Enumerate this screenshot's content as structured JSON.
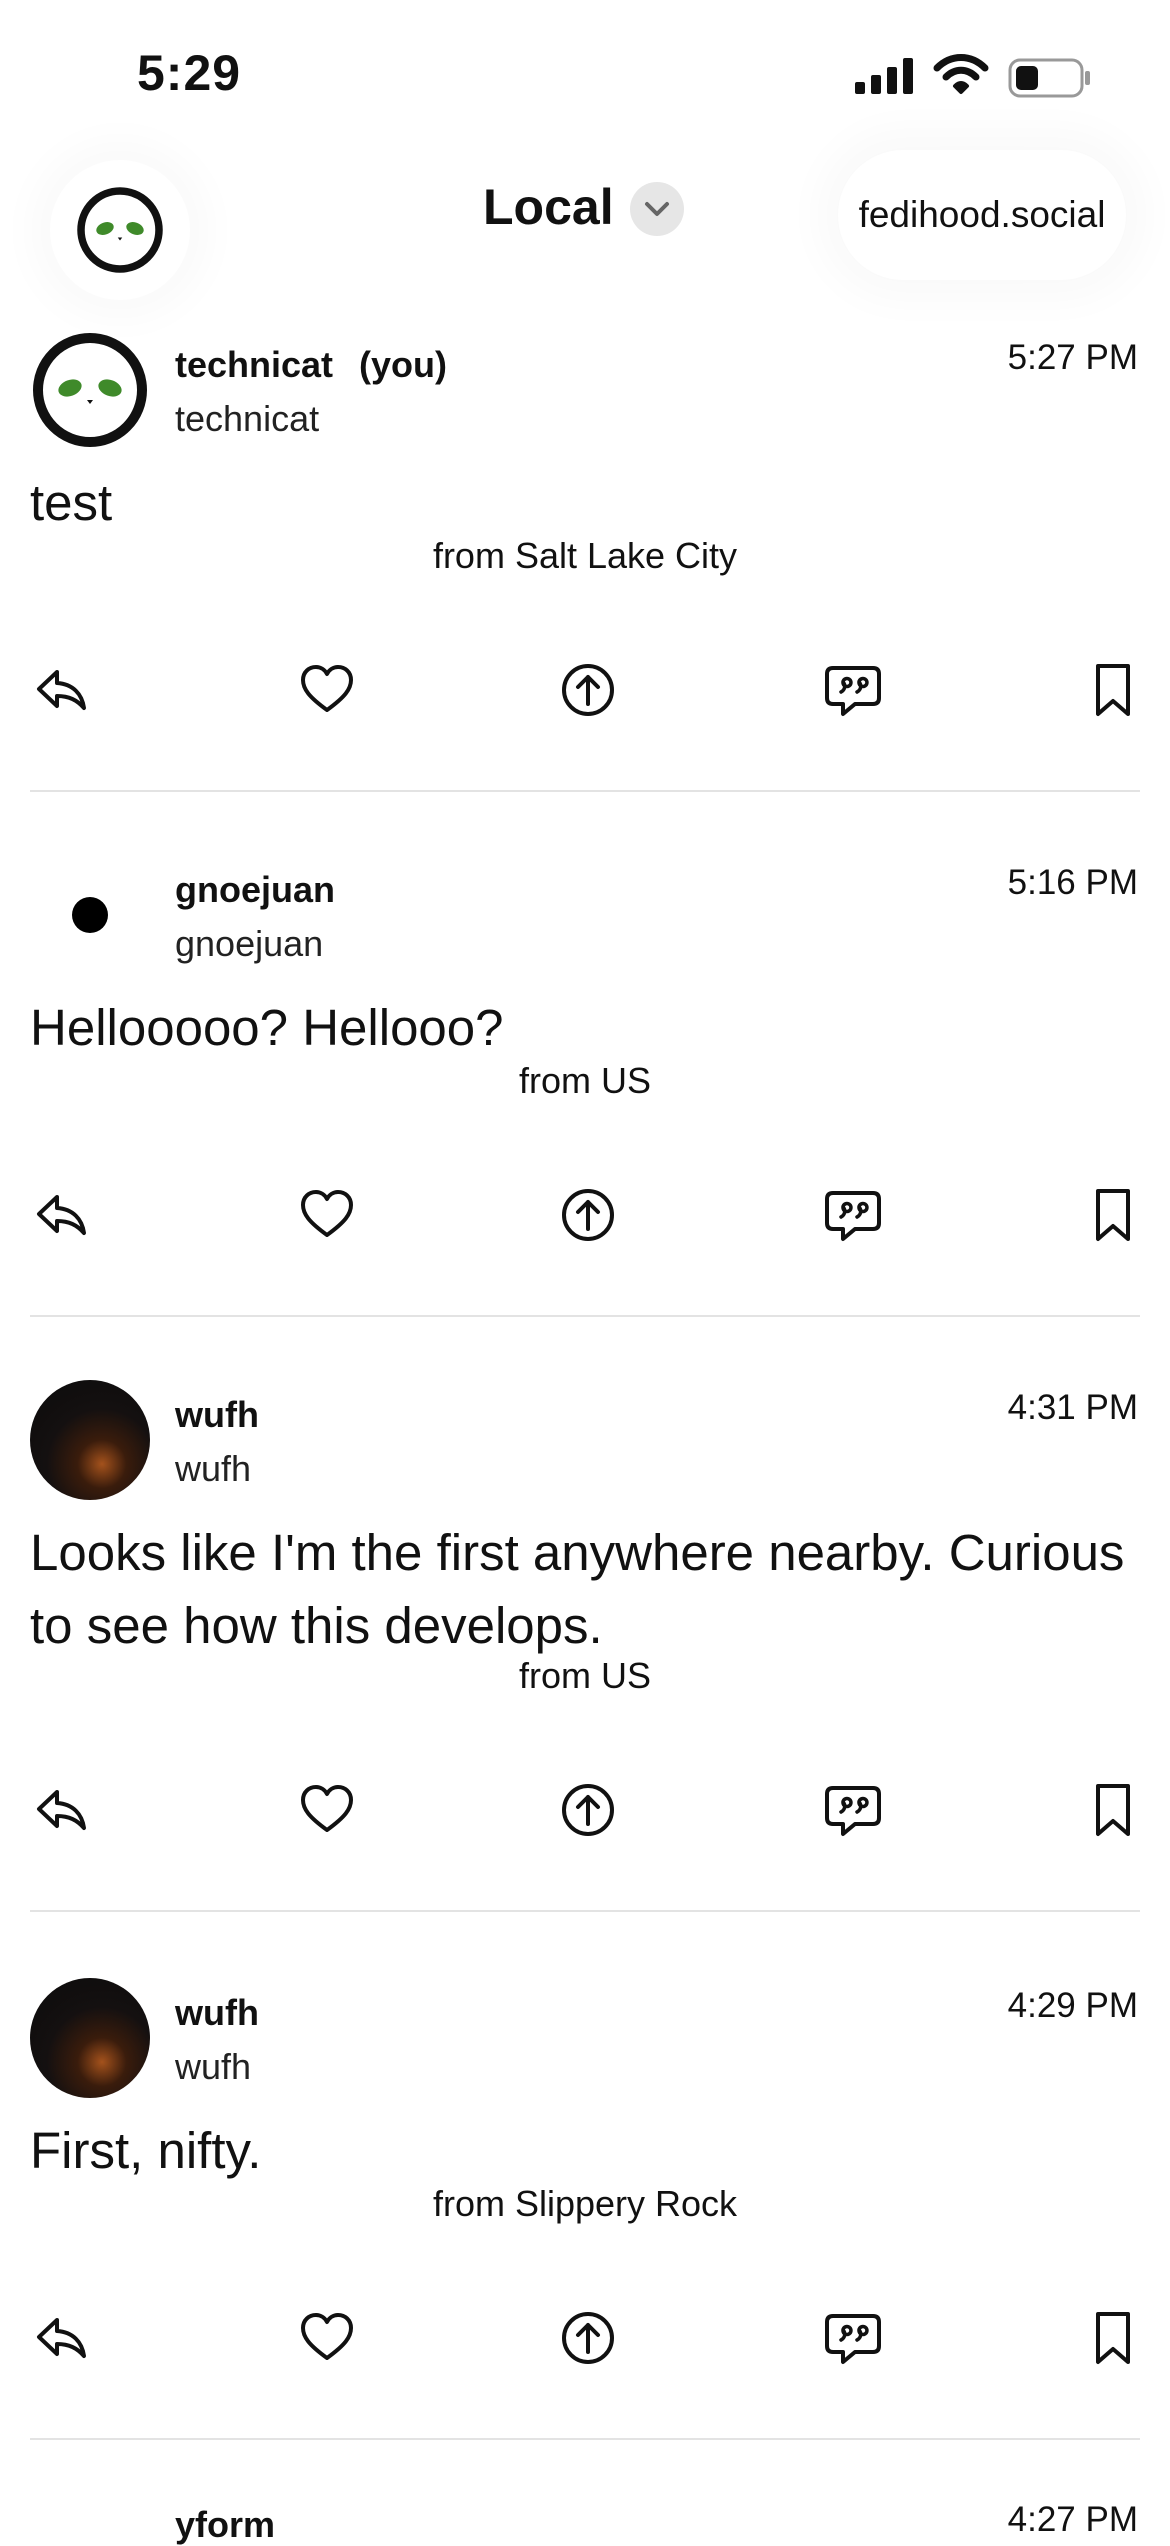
{
  "status_bar": {
    "time": "5:29"
  },
  "header": {
    "feed_title": "Local",
    "instance": "fedihood.social"
  },
  "posts": [
    {
      "display_name": "technicat",
      "you_label": "(you)",
      "handle": "technicat",
      "time": "5:27 PM",
      "body": "test",
      "location": "from Salt Lake City"
    },
    {
      "display_name": "gnoejuan",
      "handle": "gnoejuan",
      "time": "5:16 PM",
      "body": "Hellooooo? Hellooo?",
      "location": "from US"
    },
    {
      "display_name": "wufh",
      "handle": "wufh",
      "time": "4:31 PM",
      "body": "Looks like I'm the first anywhere nearby. Curious to see how this develops.",
      "location": "from US"
    },
    {
      "display_name": "wufh",
      "handle": "wufh",
      "time": "4:29 PM",
      "body": "First, nifty.",
      "location": "from Slippery Rock"
    },
    {
      "display_name": "yform",
      "time": "4:27 PM"
    }
  ],
  "icons": {
    "reply": "reply-icon",
    "like": "heart-icon",
    "boost": "boost-icon",
    "quote": "quote-icon",
    "bookmark": "bookmark-icon"
  },
  "colors": {
    "alien_eye": "#3f8a2a",
    "divider": "#e3e3e3",
    "chevron_bg": "#e6e6e6"
  }
}
